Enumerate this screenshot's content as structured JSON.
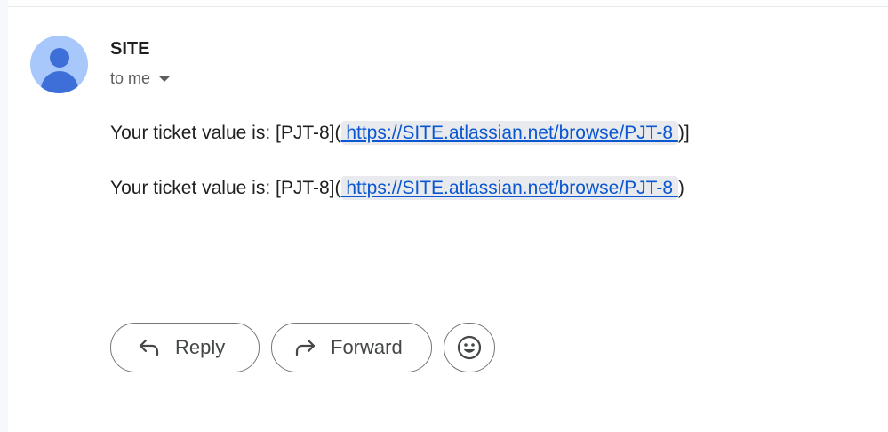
{
  "message": {
    "sender": "SITE",
    "recipient_label": "to me",
    "lines": [
      {
        "prefix": "Your ticket value is: [PJT-8](",
        "link": " https://SITE.atlassian.net/browse/PJT-8 ",
        "suffix": ")]"
      },
      {
        "prefix": "Your ticket value is: [PJT-8](",
        "link": " https://SITE.atlassian.net/browse/PJT-8 ",
        "suffix": ")"
      }
    ]
  },
  "actions": {
    "reply_label": "Reply",
    "forward_label": "Forward"
  },
  "icons": {
    "avatar": "person-avatar-icon",
    "recipient_details": "caret-down-icon",
    "reply": "reply-arrow-icon",
    "forward": "forward-arrow-icon",
    "emoji": "smiley-face-icon"
  },
  "colors": {
    "link": "#0b57d0",
    "link_background": "#e8eaed",
    "avatar_background": "#a8c7fa",
    "avatar_figure": "#3e6fd9"
  }
}
